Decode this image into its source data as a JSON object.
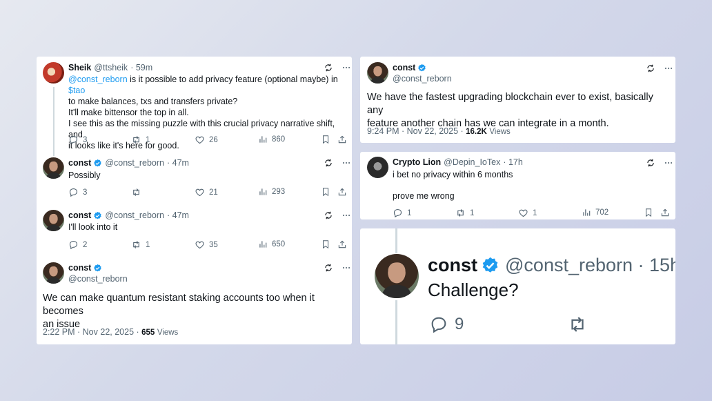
{
  "left_card": {
    "tweets": [
      {
        "name": "Sheik",
        "handle": "@ttsheik",
        "time": "· 59m",
        "text_lines": [
          {
            "mention": "@const_reborn",
            "mid": " is it possible to add privacy feature (optional maybe) in ",
            "cashtag": "$tao"
          },
          "to make balances, txs and transfers private?",
          "It'll make bittensor the top in all.",
          "I see this as the missing puzzle with this crucial privacy narrative shift, and",
          "it looks like it's here for good."
        ],
        "replies": "3",
        "reposts": "1",
        "likes": "26",
        "views": "860"
      },
      {
        "name": "const",
        "handle": "@const_reborn",
        "time": "· 47m",
        "text": "Possibly",
        "replies": "3",
        "reposts": "",
        "likes": "21",
        "views": "293"
      },
      {
        "name": "const",
        "handle": "@const_reborn",
        "time": "· 47m",
        "text": "I'll look into it",
        "replies": "2",
        "reposts": "1",
        "likes": "35",
        "views": "650"
      },
      {
        "name": "const",
        "handle": "@const_reborn",
        "text_lines": [
          "We can make quantum resistant staking accounts too when it becomes",
          "an issue"
        ],
        "timestamp": "2:22 PM · Nov 22, 2025 ·",
        "views_count": "655",
        "views_label": "Views"
      }
    ]
  },
  "right_top_card": {
    "name": "const",
    "handle": "@const_reborn",
    "text_lines": [
      "We have the fastest upgrading blockchain ever to exist, basically any",
      "feature another chain has we can integrate in a month."
    ],
    "timestamp": "9:24 PM · Nov 22, 2025 ·",
    "views_count": "16.2K",
    "views_label": "Views"
  },
  "right_mid_card": {
    "name": "Crypto Lion",
    "handle": "@Depin_IoTex",
    "time": "· 17h",
    "text_line1": "i bet no privacy within 6 months",
    "text_line2": "prove me wrong",
    "replies": "1",
    "reposts": "1",
    "likes": "1",
    "views": "702"
  },
  "right_bottom_card": {
    "name": "const",
    "handle": "@const_reborn · 15h",
    "text": "Challenge?",
    "replies": "9"
  },
  "colors": {
    "accent": "#1d9bf0",
    "secondary_text": "#536471",
    "verified": "#1d9bf0"
  },
  "icons": [
    "grok-icon",
    "more-icon",
    "reply-icon",
    "repost-icon",
    "like-icon",
    "views-icon",
    "bookmark-icon",
    "share-icon",
    "verified-badge-icon"
  ]
}
